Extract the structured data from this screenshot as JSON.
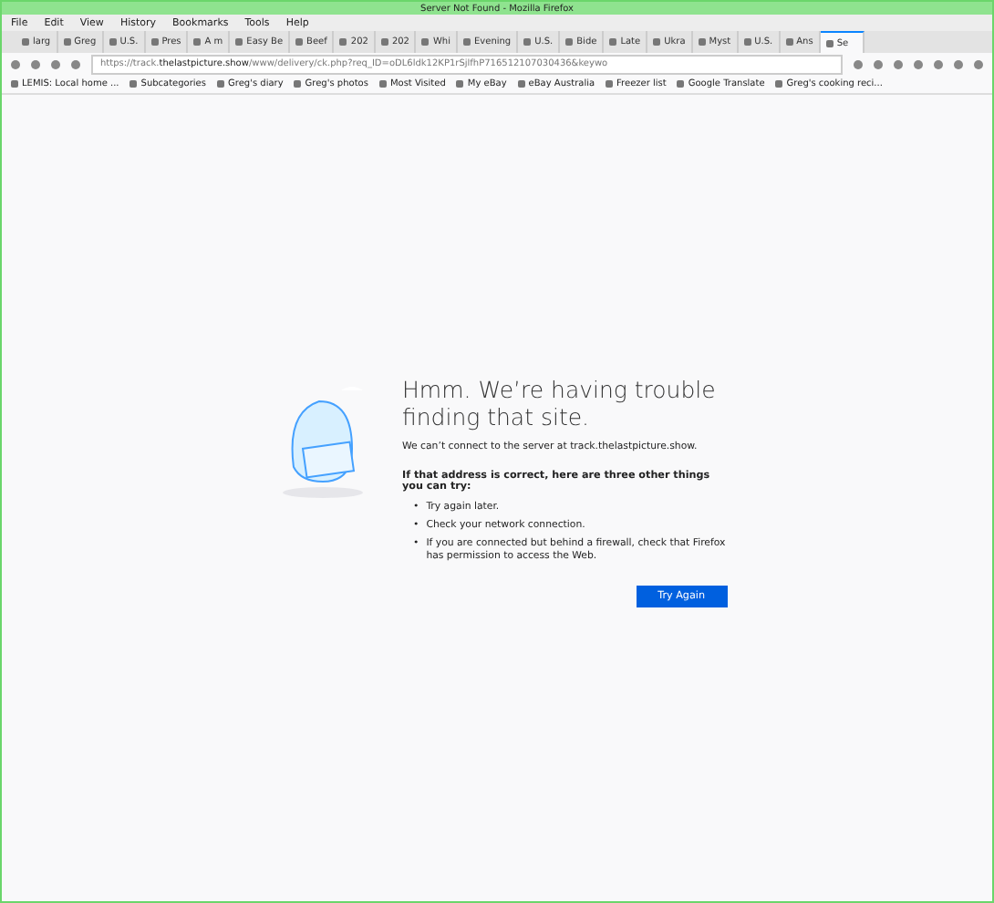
{
  "window": {
    "title": "Server Not Found - Mozilla Firefox"
  },
  "menu": [
    "File",
    "Edit",
    "View",
    "History",
    "Bookmarks",
    "Tools",
    "Help"
  ],
  "tabs": [
    {
      "label": "larg",
      "selected": false
    },
    {
      "label": "Greg",
      "selected": false
    },
    {
      "label": "U.S.",
      "selected": false
    },
    {
      "label": "Pres",
      "selected": false
    },
    {
      "label": "A m",
      "selected": false
    },
    {
      "label": "Easy Be",
      "selected": false
    },
    {
      "label": "Beef",
      "selected": false
    },
    {
      "label": "202",
      "selected": false
    },
    {
      "label": "202",
      "selected": false
    },
    {
      "label": "Whi",
      "selected": false
    },
    {
      "label": "Evening",
      "selected": false
    },
    {
      "label": "U.S.",
      "selected": false
    },
    {
      "label": "Bide",
      "selected": false
    },
    {
      "label": "Late",
      "selected": false
    },
    {
      "label": "Ukra",
      "selected": false
    },
    {
      "label": "Myst",
      "selected": false
    },
    {
      "label": "U.S.",
      "selected": false
    },
    {
      "label": "Ans",
      "selected": false
    },
    {
      "label": "Se",
      "selected": true
    }
  ],
  "url": {
    "prefix": "https://track.",
    "domain": "thelastpicture.show",
    "rest": "/www/delivery/ck.php?req_ID=oDL6ldk12KP1rSjlfhP716512107030436&keywo"
  },
  "bookmarks": [
    "LEMIS: Local home ...",
    "Subcategories",
    "Greg's diary",
    "Greg's photos",
    "Most Visited",
    "My eBay",
    "eBay Australia",
    "Freezer list",
    "Google Translate",
    "Greg's cooking reci..."
  ],
  "error": {
    "title": "Hmm. We’re having trouble finding that site.",
    "message": "We can’t connect to the server at track.thelastpicture.show.",
    "subtitle": "If that address is correct, here are three other things you can try:",
    "tips": [
      "Try again later.",
      "Check your network connection.",
      "If you are connected but behind a firewall, check that Firefox has permission to access the Web."
    ],
    "bullet": "•",
    "button": "Try Again"
  }
}
